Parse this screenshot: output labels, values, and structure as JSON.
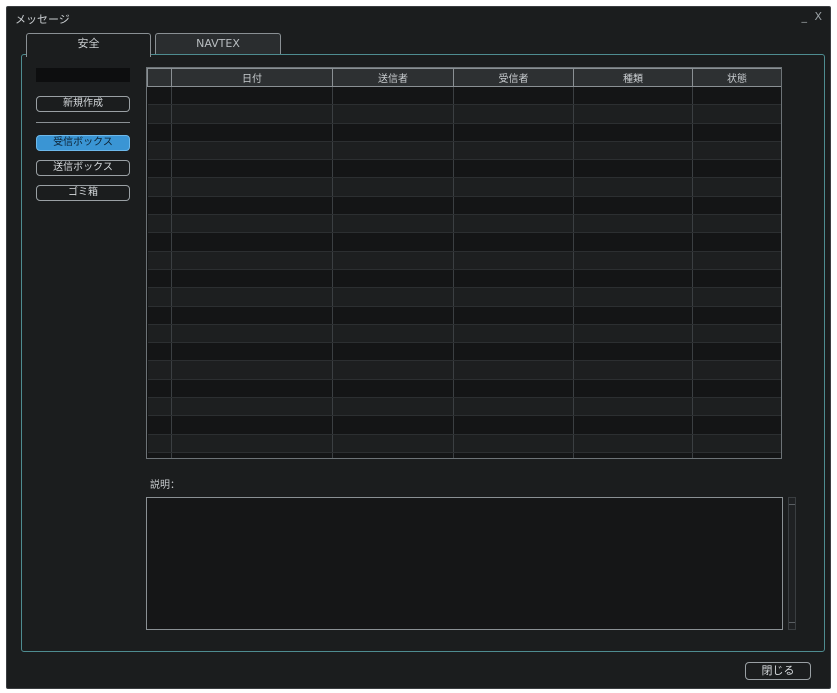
{
  "window": {
    "title": "メッセージ",
    "controls": "_ X"
  },
  "tabs": [
    {
      "label": "安全",
      "active": true
    },
    {
      "label": "NAVTEX",
      "active": false
    }
  ],
  "sidebar": {
    "new_button": "新規作成",
    "folders": [
      {
        "label": "受信ボックス",
        "selected": true
      },
      {
        "label": "送信ボックス",
        "selected": false
      },
      {
        "label": "ゴミ箱",
        "selected": false
      }
    ]
  },
  "table": {
    "columns": [
      "",
      "日付",
      "送信者",
      "受信者",
      "種類",
      "状態"
    ],
    "row_count": 21
  },
  "description": {
    "label": "説明：",
    "value": ""
  },
  "footer": {
    "close_label": "閉じる"
  },
  "colors": {
    "accent": "#3a95d4",
    "panel_border": "#4e8c90",
    "background": "#1b1d1e"
  }
}
